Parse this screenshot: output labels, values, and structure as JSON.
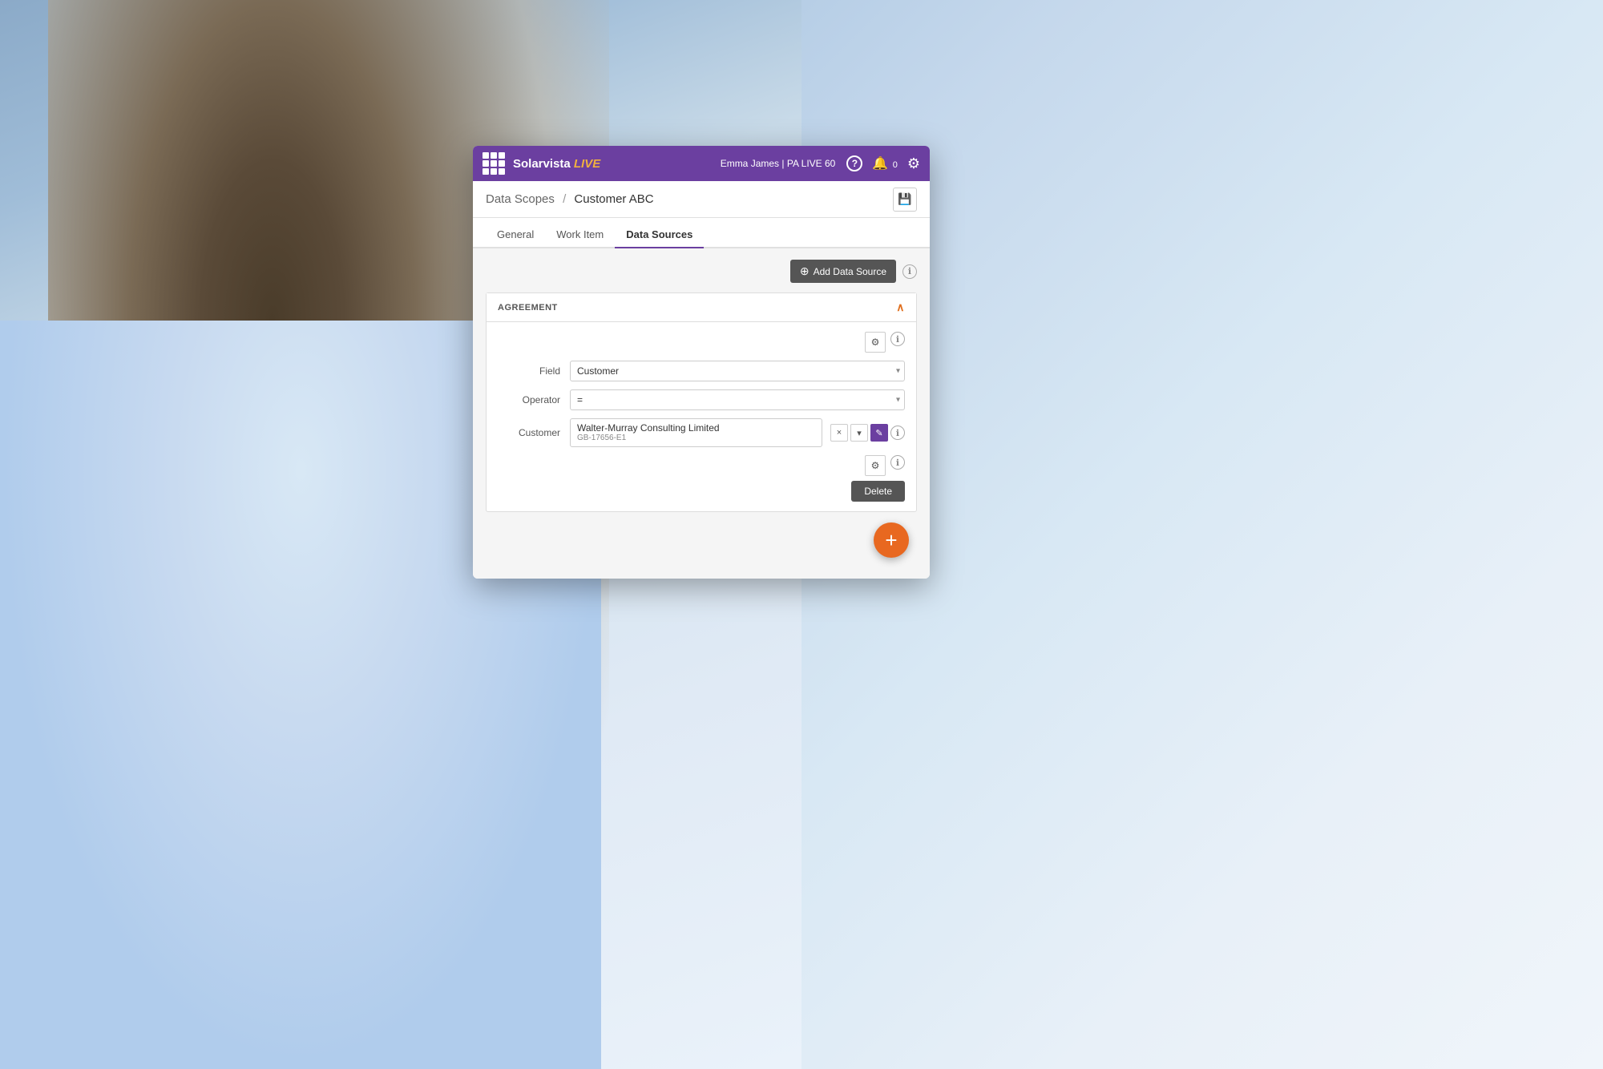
{
  "background": {
    "colors": [
      "#b8cfe8",
      "#d0e4f4",
      "#e8f2fa"
    ]
  },
  "header": {
    "brand": "Solarvista",
    "live_label": "LIVE",
    "user": "Emma James",
    "separator": "|",
    "plan": "PA LIVE 60",
    "help_icon": "?",
    "notifications_count": "0",
    "gear_icon": "⚙"
  },
  "breadcrumb": {
    "section": "Data Scopes",
    "separator": "/",
    "page": "Customer ABC",
    "save_icon": "💾"
  },
  "tabs": [
    {
      "id": "general",
      "label": "General",
      "active": false
    },
    {
      "id": "work-item",
      "label": "Work Item",
      "active": false
    },
    {
      "id": "data-sources",
      "label": "Data Sources",
      "active": true
    }
  ],
  "toolbar": {
    "add_datasource_label": "Add Data Source",
    "add_icon": "⊕",
    "info_icon": "ℹ"
  },
  "agreement_section": {
    "title": "AGREEMENT",
    "collapse_icon": "∧",
    "settings_icon": "⚙",
    "info_icon": "ℹ",
    "field_label": "Field",
    "field_value": "Customer",
    "operator_label": "Operator",
    "operator_value": "=",
    "customer_label": "Customer",
    "customer_name": "Walter-Murray Consulting Limited",
    "customer_code": "GB-17656-E1",
    "bottom_settings_icon": "⚙",
    "bottom_info_icon": "ℹ",
    "delete_button": "Delete"
  },
  "fab": {
    "icon": "+",
    "color": "#e86820"
  }
}
